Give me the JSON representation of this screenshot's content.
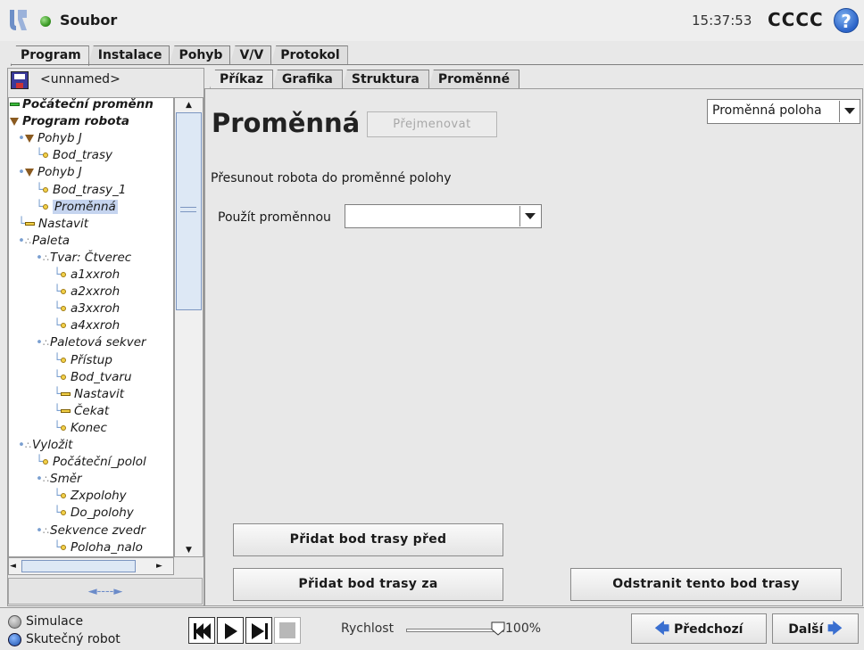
{
  "header": {
    "file_label": "Soubor",
    "clock": "15:37:53",
    "robot_name": "CCCC",
    "help_glyph": "?"
  },
  "main_tabs": [
    "Program",
    "Instalace",
    "Pohyb",
    "V/V",
    "Protokol"
  ],
  "active_main_tab": "Program",
  "left_panel": {
    "program_name": "<unnamed>",
    "tree": [
      {
        "label": "Počáteční proměnn",
        "icon": "init-vars-icon",
        "depth": 0,
        "bold": true
      },
      {
        "label": "Program robota",
        "icon": "triangle-icon",
        "depth": 0,
        "bold": true
      },
      {
        "label": "Pohyb J",
        "icon": "triangle-icon",
        "depth": 1
      },
      {
        "label": "Bod_trasy",
        "icon": "waypoint-icon",
        "depth": 2
      },
      {
        "label": "Pohyb J",
        "icon": "triangle-icon",
        "depth": 1
      },
      {
        "label": "Bod_trasy_1",
        "icon": "waypoint-icon",
        "depth": 2
      },
      {
        "label": "Proměnná",
        "icon": "waypoint-icon",
        "depth": 2,
        "selected": true
      },
      {
        "label": "Nastavit",
        "icon": "set-icon",
        "depth": 1
      },
      {
        "label": "Paleta",
        "icon": "pallet-icon",
        "depth": 1
      },
      {
        "label": "Tvar: Čtverec",
        "icon": "pallet-icon",
        "depth": 2
      },
      {
        "label": "a1xxroh",
        "icon": "waypoint-icon",
        "depth": 3
      },
      {
        "label": "a2xxroh",
        "icon": "waypoint-icon",
        "depth": 3
      },
      {
        "label": "a3xxroh",
        "icon": "waypoint-icon",
        "depth": 3
      },
      {
        "label": "a4xxroh",
        "icon": "waypoint-icon",
        "depth": 3
      },
      {
        "label": "Paletová sekver",
        "icon": "pallet-icon",
        "depth": 2
      },
      {
        "label": "Přístup",
        "icon": "waypoint-icon",
        "depth": 3
      },
      {
        "label": "Bod_tvaru",
        "icon": "waypoint-icon",
        "depth": 3
      },
      {
        "label": "Nastavit",
        "icon": "set-icon",
        "depth": 3
      },
      {
        "label": "Čekat",
        "icon": "set-icon",
        "depth": 3
      },
      {
        "label": "Konec",
        "icon": "waypoint-icon",
        "depth": 3
      },
      {
        "label": "Vyložit",
        "icon": "pallet-icon",
        "depth": 1
      },
      {
        "label": "Počáteční_polol",
        "icon": "waypoint-icon",
        "depth": 2
      },
      {
        "label": "Směr",
        "icon": "pallet-icon",
        "depth": 2
      },
      {
        "label": "Zxpolohy",
        "icon": "waypoint-icon",
        "depth": 3
      },
      {
        "label": "Do_polohy",
        "icon": "waypoint-icon",
        "depth": 3
      },
      {
        "label": "Sekvence zvedr",
        "icon": "pallet-icon",
        "depth": 2
      },
      {
        "label": "Poloha_nalo",
        "icon": "waypoint-icon",
        "depth": 3
      }
    ],
    "collapse_glyph": "◄----►"
  },
  "sub_tabs": [
    "Příkaz",
    "Grafika",
    "Struktura",
    "Proměnné"
  ],
  "active_sub_tab": "Příkaz",
  "command": {
    "title": "Proměnná",
    "rename_label": "Přejmenovat",
    "var_type_selected": "Proměnná poloha",
    "description": "Přesunout robota do proměnné polohy",
    "use_var_label": "Použít proměnnou",
    "use_var_value": "",
    "add_before_label": "Přidat bod trasy před",
    "add_after_label": "Přidat bod trasy za",
    "remove_label": "Odstranit tento bod trasy"
  },
  "footer": {
    "simulation_label": "Simulace",
    "real_robot_label": "Skutečný robot",
    "mode_selected": "Skutečný robot",
    "speed_label": "Rychlost",
    "speed_value": "100%",
    "speed_fraction": 1.0,
    "prev_label": "Předchozí",
    "next_label": "Další"
  },
  "colors": {
    "status_ok": "#3a9a24",
    "accent_blue": "#2b63c8",
    "selection": "#c5d4ef"
  }
}
